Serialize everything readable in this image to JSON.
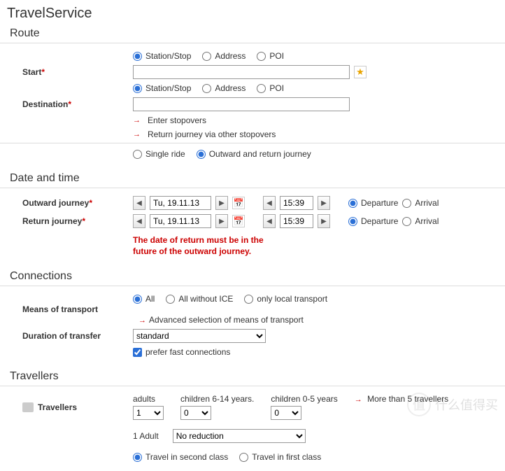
{
  "page_title": "TravelService",
  "route": {
    "heading": "Route",
    "start_label": "Start",
    "dest_label": "Destination",
    "type_options": {
      "station": "Station/Stop",
      "address": "Address",
      "poi": "POI"
    },
    "start_value": "",
    "dest_value": "",
    "stopovers_link": "Enter stopovers",
    "return_stopovers_link": "Return journey via other stopovers",
    "trip_type": {
      "single": "Single ride",
      "return": "Outward and return journey"
    }
  },
  "datetime": {
    "heading": "Date and time",
    "outward_label": "Outward journey",
    "return_label": "Return journey",
    "outward_date": "Tu, 19.11.13",
    "outward_time": "15:39",
    "return_date": "Tu, 19.11.13",
    "return_time": "15:39",
    "deparr": {
      "dep": "Departure",
      "arr": "Arrival"
    },
    "error": "The date of return must be in the future of the outward journey."
  },
  "connections": {
    "heading": "Connections",
    "means_label": "Means of transport",
    "duration_label": "Duration of transfer",
    "means": {
      "all": "All",
      "noice": "All without ICE",
      "local": "only local transport"
    },
    "advanced_link": "Advanced selection of means of transport",
    "duration_value": "standard",
    "prefer_fast": "prefer fast connections"
  },
  "travellers": {
    "heading": "Travellers",
    "label": "Travellers",
    "adults_head": "adults",
    "children614_head": "children 6-14 years.",
    "children05_head": "children 0-5 years",
    "adults_value": "1",
    "children614_value": "0",
    "children05_value": "0",
    "more_link": "More than 5 travellers",
    "summary": "1 Adult",
    "reduction_value": "No reduction",
    "class": {
      "second": "Travel in second class",
      "first": "Travel in first class"
    }
  },
  "watermark": "什么值得买"
}
